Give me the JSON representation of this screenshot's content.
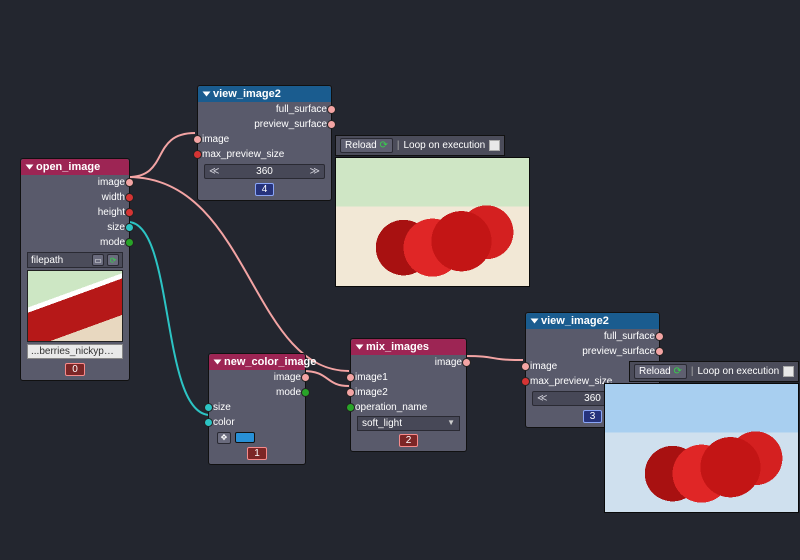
{
  "nodes": {
    "open_image": {
      "title": "open_image",
      "outputs": [
        "image",
        "width",
        "height",
        "size",
        "mode"
      ],
      "param_label": "filepath",
      "filename": "...berries_nickype.jpg",
      "badge": "0"
    },
    "view_image2_top": {
      "title": "view_image2",
      "outputs": [
        "full_surface",
        "preview_surface"
      ],
      "inputs": [
        "image",
        "max_preview_size"
      ],
      "spinner_value": "360",
      "badge": "4"
    },
    "new_color_image": {
      "title": "new_color_image",
      "inputs": [
        "size",
        "color"
      ],
      "outputs": [
        "image",
        "mode"
      ],
      "badge": "1"
    },
    "mix_images": {
      "title": "mix_images",
      "inputs": [
        "image1",
        "image2",
        "operation_name"
      ],
      "outputs": [
        "image"
      ],
      "operation_value": "soft_light",
      "badge": "2"
    },
    "view_image2_right": {
      "title": "view_image2",
      "outputs": [
        "full_surface",
        "preview_surface"
      ],
      "inputs": [
        "image",
        "max_preview_size"
      ],
      "spinner_value": "360",
      "badge": "3"
    }
  },
  "toolbar": {
    "reload": "Reload",
    "loop": "Loop on execution"
  }
}
